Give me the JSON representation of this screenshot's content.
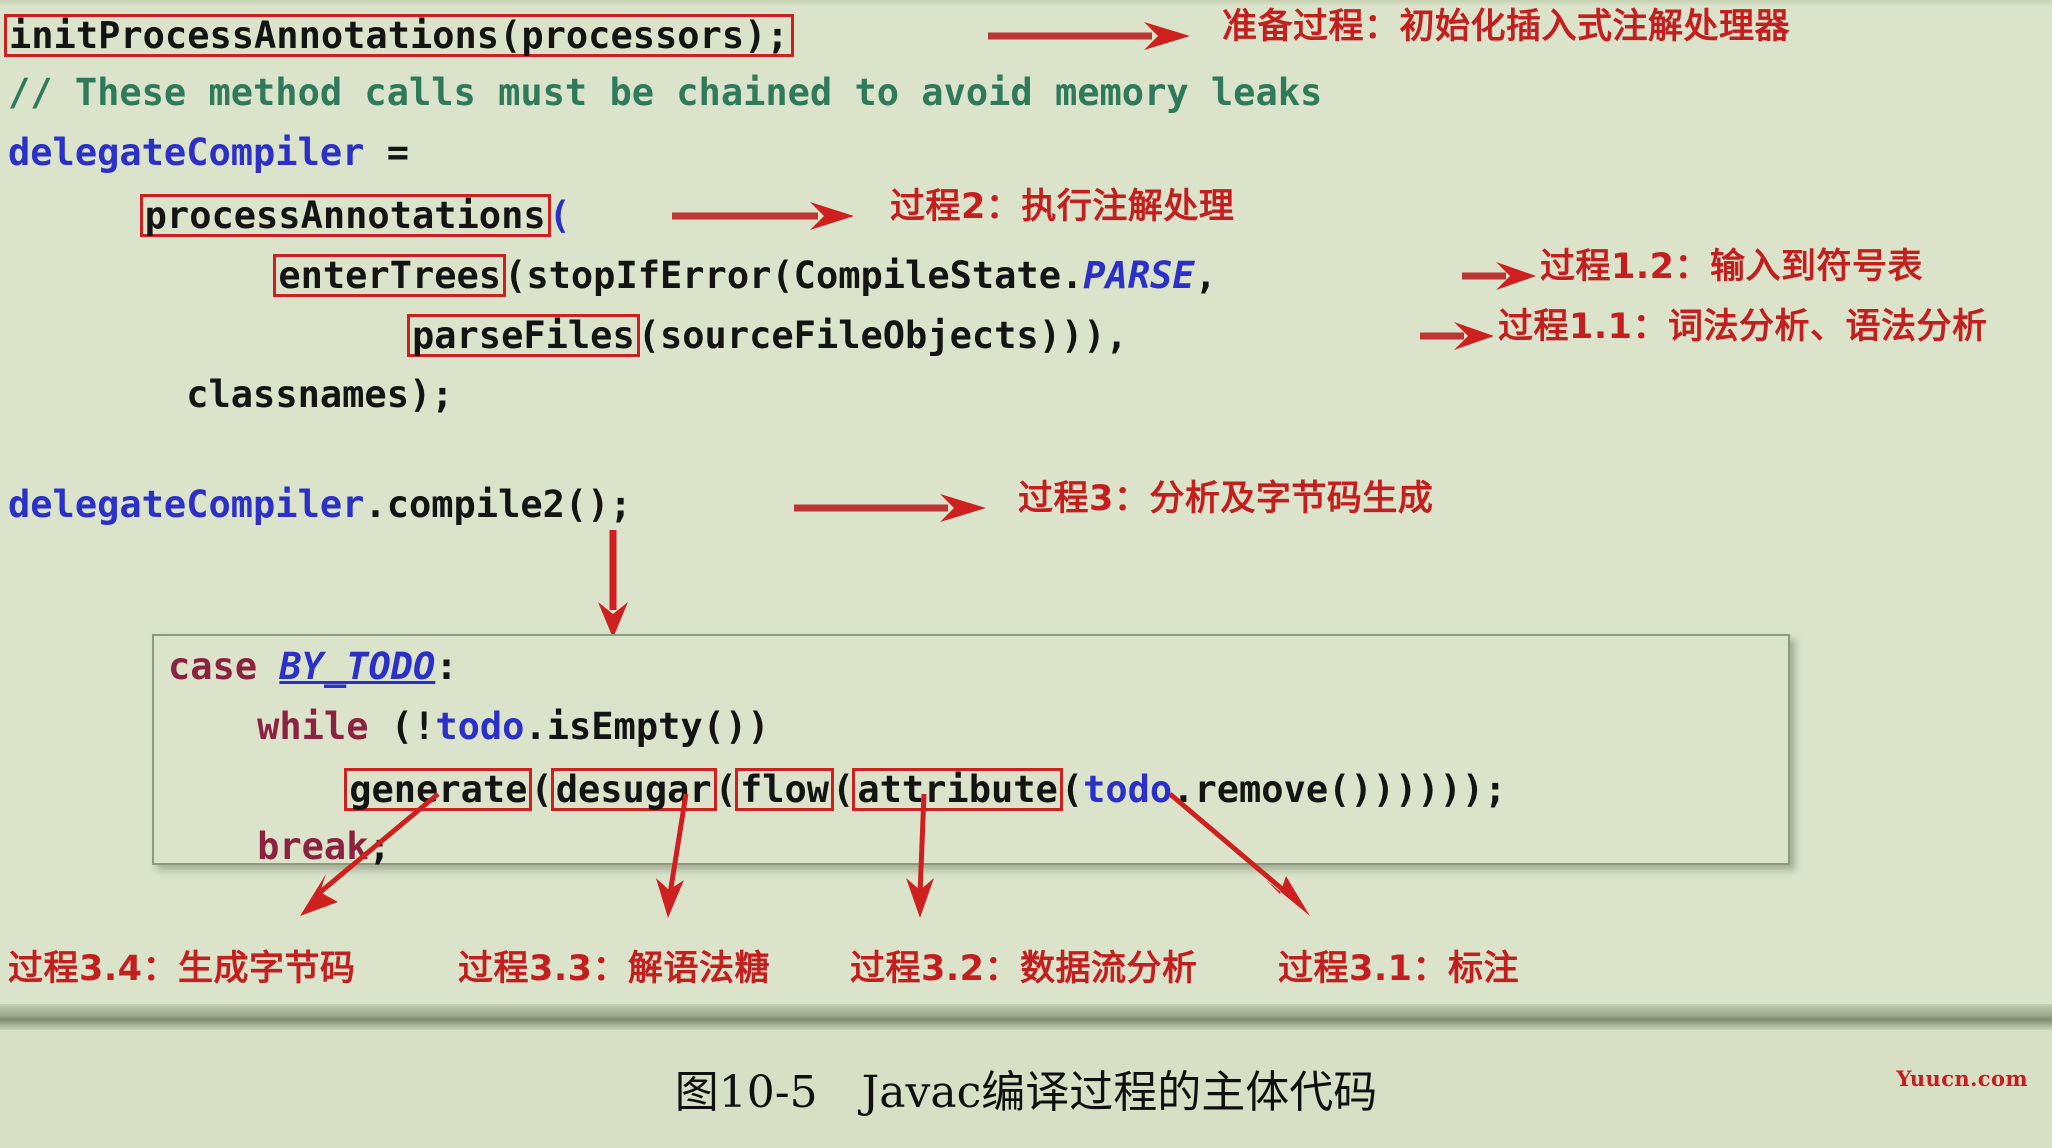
{
  "figure": {
    "caption": "图10-5　Javac编译过程的主体代码",
    "watermark": "Yuucn.com",
    "background_color": "#dbe4cb",
    "highlight_color": "#cf2020",
    "annotation_color": "#c41f1f"
  },
  "code": {
    "line1": {
      "boxed_call": "initProcessAnnotations(processors);"
    },
    "line2": {
      "comment": "// These method calls must be chained to avoid memory leaks"
    },
    "line3": {
      "var": "delegateCompiler",
      "assign": " ="
    },
    "line4": {
      "indent": "      ",
      "boxed_method": "processAnnotations",
      "rest": "("
    },
    "line5": {
      "indent": "            ",
      "boxed_method": "enterTrees",
      "rest_a": "(stopIfError(CompileState.",
      "const": "PARSE",
      "rest_b": ","
    },
    "line6": {
      "indent": "                  ",
      "boxed_method": "parseFiles",
      "rest": "(sourceFileObjects))),"
    },
    "line7": {
      "indent": "        ",
      "text": "classnames);"
    },
    "line8": {
      "var": "delegateCompiler",
      "rest": ".compile2();"
    },
    "panel": {
      "line1_kw": "case",
      "line1_const": "BY_TODO",
      "line1_colon": ":",
      "line2_indent": "    ",
      "line2_kw": "while",
      "line2_a": " (!",
      "line2_var": "todo",
      "line2_b": ".isEmpty())",
      "line3_indent": "        ",
      "line3_box1": "generate",
      "line3_sep1": "(",
      "line3_box2": "desugar",
      "line3_sep2": "(",
      "line3_box3": "flow",
      "line3_sep3": "(",
      "line3_box4": "attribute",
      "line3_a": "(",
      "line3_var": "todo",
      "line3_b": ".remove())))));",
      "line4_indent": "    ",
      "line4_kw": "break",
      "line4_semi": ";"
    }
  },
  "annotations": {
    "prep": "准备过程：初始化插入式注解处理器",
    "process2": "过程2：执行注解处理",
    "process1_2": "过程1.2：输入到符号表",
    "process1_1": "过程1.1：词法分析、语法分析",
    "process3": "过程3：分析及字节码生成",
    "process3_4": "过程3.4：生成字节码",
    "process3_3": "过程3.3：解语法糖",
    "process3_2": "过程3.2：数据流分析",
    "process3_1": "过程3.1：标注"
  }
}
